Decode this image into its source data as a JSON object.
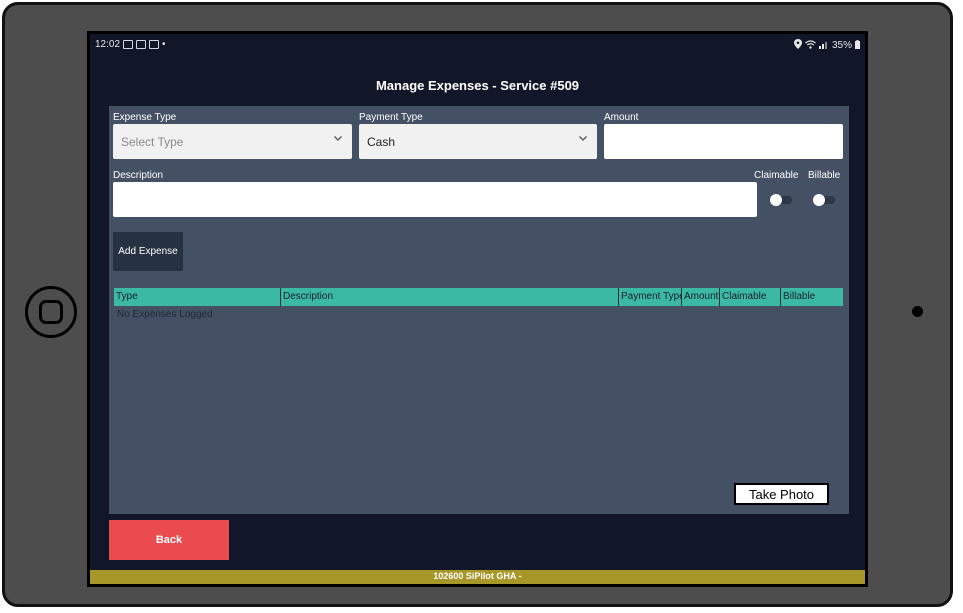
{
  "status": {
    "time": "12:02",
    "dot": "•",
    "battery": "35%"
  },
  "page": {
    "title": "Manage Expenses  -  Service #509"
  },
  "form": {
    "expense_type_label": "Expense Type",
    "expense_type_value": "Select Type",
    "payment_type_label": "Payment Type",
    "payment_type_value": "Cash",
    "amount_label": "Amount",
    "amount_value": "",
    "description_label": "Description",
    "description_value": "",
    "claimable_label": "Claimable",
    "billable_label": "Billable",
    "claimable_on": false,
    "billable_on": false,
    "add_button": "Add Expense"
  },
  "table": {
    "columns": [
      "Type",
      "Description",
      "Payment Type",
      "Amount",
      "Claimable",
      "Billable"
    ],
    "rows": [],
    "empty_message": "No Expenses Logged"
  },
  "actions": {
    "take_photo": "Take Photo",
    "back": "Back"
  },
  "footer": {
    "text": "102600 SiPilot GHA -"
  },
  "colors": {
    "header_teal": "#3bb9a5",
    "back_red": "#e94b4f",
    "panel": "#445063",
    "footer_gold": "#a79728"
  },
  "icons": [
    "home-button-icon",
    "camera-icon",
    "location-icon",
    "wifi-icon",
    "signal-icon",
    "battery-icon",
    "chevron-down-icon"
  ]
}
